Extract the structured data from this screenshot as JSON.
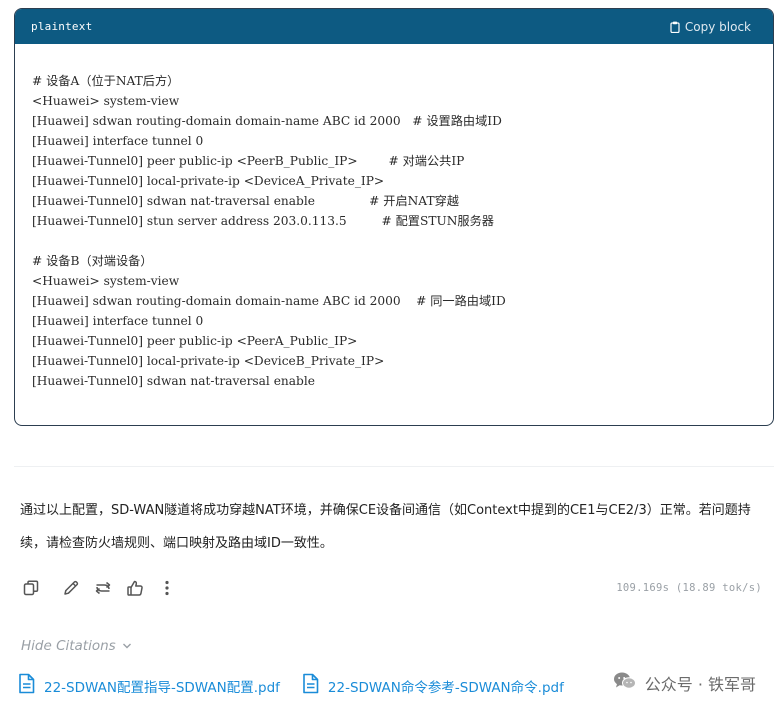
{
  "code_block": {
    "language": "plaintext",
    "copy_label": "Copy block",
    "lines": [
      "# 设备A（位于NAT后方）",
      "<Huawei> system-view",
      "[Huawei] sdwan routing-domain domain-name ABC id 2000   # 设置路由域ID",
      "[Huawei] interface tunnel 0",
      "[Huawei-Tunnel0] peer public-ip <PeerB_Public_IP>        # 对端公共IP",
      "[Huawei-Tunnel0] local-private-ip <DeviceA_Private_IP>",
      "[Huawei-Tunnel0] sdwan nat-traversal enable              # 开启NAT穿越",
      "[Huawei-Tunnel0] stun server address 203.0.113.5         # 配置STUN服务器",
      "",
      "# 设备B（对端设备）",
      "<Huawei> system-view",
      "[Huawei] sdwan routing-domain domain-name ABC id 2000    # 同一路由域ID",
      "[Huawei] interface tunnel 0",
      "[Huawei-Tunnel0] peer public-ip <PeerA_Public_IP>",
      "[Huawei-Tunnel0] local-private-ip <DeviceB_Private_IP>",
      "[Huawei-Tunnel0] sdwan nat-traversal enable"
    ]
  },
  "answer_text": "通过以上配置，SD-WAN隧道将成功穿越NAT环境，并确保CE设备间通信（如Context中提到的CE1与CE2/3）正常。若问题持续，请检查防火墙规则、端口映射及路由域ID一致性。",
  "actions": {
    "icons": [
      "copy-icon",
      "edit-icon",
      "regenerate-icon",
      "thumbs-up-icon",
      "more-icon"
    ]
  },
  "generation_stats": "109.169s (18.89 tok/s)",
  "citations": {
    "toggle_label": "Hide Citations",
    "items": [
      {
        "label": "22-SDWAN配置指导-SDWAN配置.pdf",
        "icon": "pdf-file-icon"
      },
      {
        "label": "22-SDWAN命令参考-SDWAN命令.pdf",
        "icon": "pdf-file-icon"
      }
    ]
  },
  "watermark": {
    "text": "公众号 · 铁军哥",
    "icon": "wechat-icon"
  },
  "colors": {
    "header_bg": "#0d5a82",
    "link": "#1a8cd8",
    "muted": "#9aa0a6"
  }
}
